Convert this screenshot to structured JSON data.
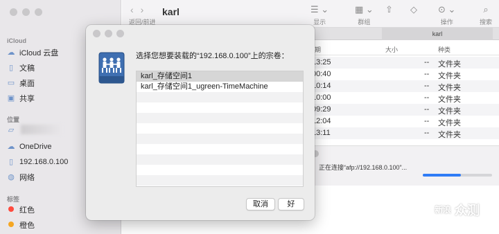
{
  "finder": {
    "title": "karl",
    "nav_label": "返回/前进",
    "tab_label": "karl",
    "sidebar": {
      "section_icloud": "iCloud",
      "icloud_items": [
        {
          "icon": "cloud-icon",
          "label": "iCloud 云盘"
        },
        {
          "icon": "document-icon",
          "label": "文稿"
        },
        {
          "icon": "desktop-icon",
          "label": "桌面"
        },
        {
          "icon": "shared-folder-icon",
          "label": "共享"
        }
      ],
      "section_locations": "位置",
      "location_items": [
        {
          "icon": "cloud-icon",
          "label": "OneDrive"
        },
        {
          "icon": "document-icon",
          "label": "192.168.0.100"
        },
        {
          "icon": "globe-icon",
          "label": "网络"
        }
      ],
      "section_tags": "标签",
      "tag_items": [
        {
          "label": "红色",
          "color": "#ff4b3e"
        },
        {
          "label": "橙色",
          "color": "#f5a623"
        }
      ]
    },
    "toolbar": {
      "view_label": "显示",
      "group_label": "群组",
      "action_label": "操作",
      "search_label": "搜索"
    },
    "columns": {
      "date": "期",
      "size": "大小",
      "kind": "种类"
    },
    "rows": [
      {
        "time": "13:25",
        "size": "--",
        "kind": "文件夹"
      },
      {
        "time": "00:40",
        "size": "--",
        "kind": "文件夹"
      },
      {
        "time": "10:14",
        "size": "--",
        "kind": "文件夹"
      },
      {
        "time": "10:00",
        "size": "--",
        "kind": "文件夹"
      },
      {
        "time": "09:29",
        "size": "--",
        "kind": "文件夹"
      },
      {
        "time": "12:04",
        "size": "--",
        "kind": "文件夹"
      },
      {
        "time": "13:11",
        "size": "--",
        "kind": "文件夹"
      }
    ],
    "progress": {
      "text": "正在连接“afp://192.168.0.100”...",
      "fraction": 0.55
    }
  },
  "dialog": {
    "prompt": "选择您想要装载的“192.168.0.100”上的宗卷：",
    "volumes": [
      {
        "label": "karl_存储空间1",
        "selected": true
      },
      {
        "label": "karl_存储空间1_ugreen-TimeMachine",
        "selected": false
      }
    ],
    "cancel_label": "取消",
    "ok_label": "好"
  },
  "watermark": {
    "seal": "新浪",
    "text": "众测"
  },
  "colors": {
    "accent": "#2f7cf6",
    "sidebar_icon": "#6e93c9"
  }
}
